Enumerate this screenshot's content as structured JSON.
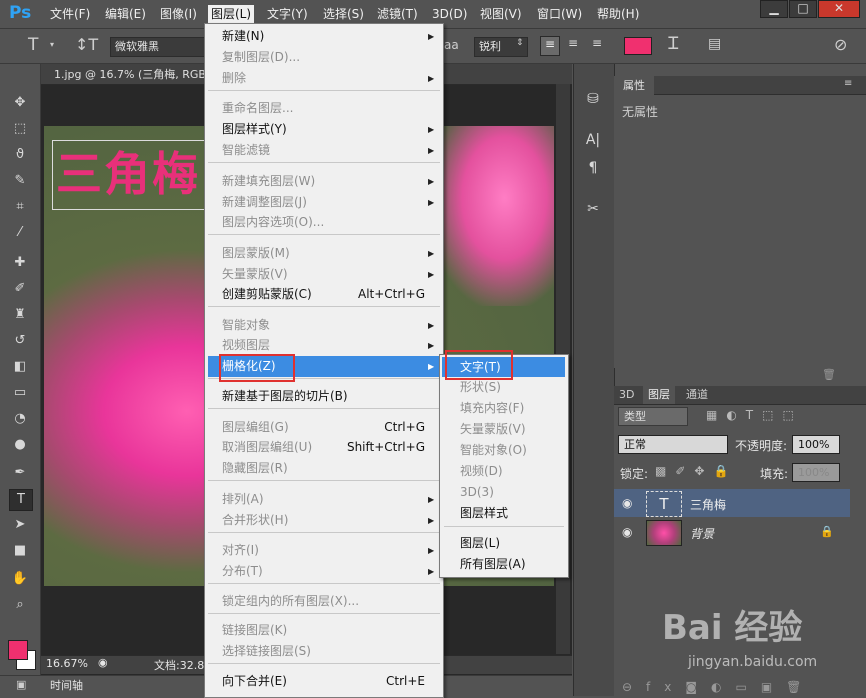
{
  "app": {
    "logo": "Ps"
  },
  "menubar": [
    "文件(F)",
    "编辑(E)",
    "图像(I)",
    "图层(L)",
    "文字(Y)",
    "选择(S)",
    "滤镜(T)",
    "3D(D)",
    "视图(V)",
    "窗口(W)",
    "帮助(H)"
  ],
  "options": {
    "font_family": "微软雅黑",
    "aa_label": "aa",
    "aa_value": "锐利",
    "text_color": "#f0306f"
  },
  "document": {
    "tab_title": "1.jpg @ 16.7% (三角梅, RGB",
    "canvas_text": "三角梅",
    "canvas_text_color": "#e8307a",
    "zoom": "16.67%",
    "doc_size": "文档:32.8"
  },
  "timeline_label": "时间轴",
  "layer_menu": {
    "items": [
      {
        "label": "新建(N)",
        "shortcut": "",
        "submenu": true,
        "disabled": false
      },
      {
        "label": "复制图层(D)...",
        "shortcut": "",
        "submenu": false,
        "disabled": true
      },
      {
        "label": "删除",
        "shortcut": "",
        "submenu": true,
        "disabled": true
      },
      {
        "label": "重命名图层...",
        "shortcut": "",
        "submenu": false,
        "disabled": true
      },
      {
        "label": "图层样式(Y)",
        "shortcut": "",
        "submenu": true,
        "disabled": false
      },
      {
        "label": "智能滤镜",
        "shortcut": "",
        "submenu": true,
        "disabled": true
      },
      {
        "label": "新建填充图层(W)",
        "shortcut": "",
        "submenu": true,
        "disabled": true
      },
      {
        "label": "新建调整图层(J)",
        "shortcut": "",
        "submenu": true,
        "disabled": true
      },
      {
        "label": "图层内容选项(O)...",
        "shortcut": "",
        "submenu": false,
        "disabled": true
      },
      {
        "label": "图层蒙版(M)",
        "shortcut": "",
        "submenu": true,
        "disabled": true
      },
      {
        "label": "矢量蒙版(V)",
        "shortcut": "",
        "submenu": true,
        "disabled": true
      },
      {
        "label": "创建剪贴蒙版(C)",
        "shortcut": "Alt+Ctrl+G",
        "submenu": false,
        "disabled": false
      },
      {
        "label": "智能对象",
        "shortcut": "",
        "submenu": true,
        "disabled": true
      },
      {
        "label": "视频图层",
        "shortcut": "",
        "submenu": true,
        "disabled": true
      },
      {
        "label": "栅格化(Z)",
        "shortcut": "",
        "submenu": true,
        "disabled": false,
        "highlighted": true
      },
      {
        "label": "新建基于图层的切片(B)",
        "shortcut": "",
        "submenu": false,
        "disabled": false
      },
      {
        "label": "图层编组(G)",
        "shortcut": "Ctrl+G",
        "submenu": false,
        "disabled": true
      },
      {
        "label": "取消图层编组(U)",
        "shortcut": "Shift+Ctrl+G",
        "submenu": false,
        "disabled": true
      },
      {
        "label": "隐藏图层(R)",
        "shortcut": "",
        "submenu": false,
        "disabled": true
      },
      {
        "label": "排列(A)",
        "shortcut": "",
        "submenu": true,
        "disabled": true
      },
      {
        "label": "合并形状(H)",
        "shortcut": "",
        "submenu": true,
        "disabled": true
      },
      {
        "label": "对齐(I)",
        "shortcut": "",
        "submenu": true,
        "disabled": true
      },
      {
        "label": "分布(T)",
        "shortcut": "",
        "submenu": true,
        "disabled": true
      },
      {
        "label": "锁定组内的所有图层(X)...",
        "shortcut": "",
        "submenu": false,
        "disabled": true
      },
      {
        "label": "链接图层(K)",
        "shortcut": "",
        "submenu": false,
        "disabled": true
      },
      {
        "label": "选择链接图层(S)",
        "shortcut": "",
        "submenu": false,
        "disabled": true
      },
      {
        "label": "向下合并(E)",
        "shortcut": "Ctrl+E",
        "submenu": false,
        "disabled": false
      }
    ]
  },
  "rasterize_submenu": {
    "items": [
      {
        "label": "文字(T)",
        "disabled": false,
        "highlighted": true
      },
      {
        "label": "形状(S)",
        "disabled": true
      },
      {
        "label": "填充内容(F)",
        "disabled": true
      },
      {
        "label": "矢量蒙版(V)",
        "disabled": true
      },
      {
        "label": "智能对象(O)",
        "disabled": true
      },
      {
        "label": "视频(D)",
        "disabled": true
      },
      {
        "label": "3D(3)",
        "disabled": true
      },
      {
        "label": "图层样式",
        "disabled": false
      },
      {
        "label": "图层(L)",
        "disabled": false
      },
      {
        "label": "所有图层(A)",
        "disabled": false
      }
    ]
  },
  "properties_panel": {
    "tab": "属性",
    "empty_text": "无属性"
  },
  "layers_panel": {
    "tabs": [
      "3D",
      "图层",
      "通道"
    ],
    "filter_label": "类型",
    "blend_mode": "正常",
    "opacity_label": "不透明度:",
    "opacity_value": "100%",
    "lock_label": "锁定:",
    "fill_label": "填充:",
    "fill_value": "100%",
    "layers": [
      {
        "name": "三角梅",
        "type": "text",
        "selected": true
      },
      {
        "name": "背景",
        "type": "image",
        "locked": true
      }
    ]
  },
  "watermark": {
    "logo": "Bai 经验",
    "url": "jingyan.baidu.com"
  }
}
